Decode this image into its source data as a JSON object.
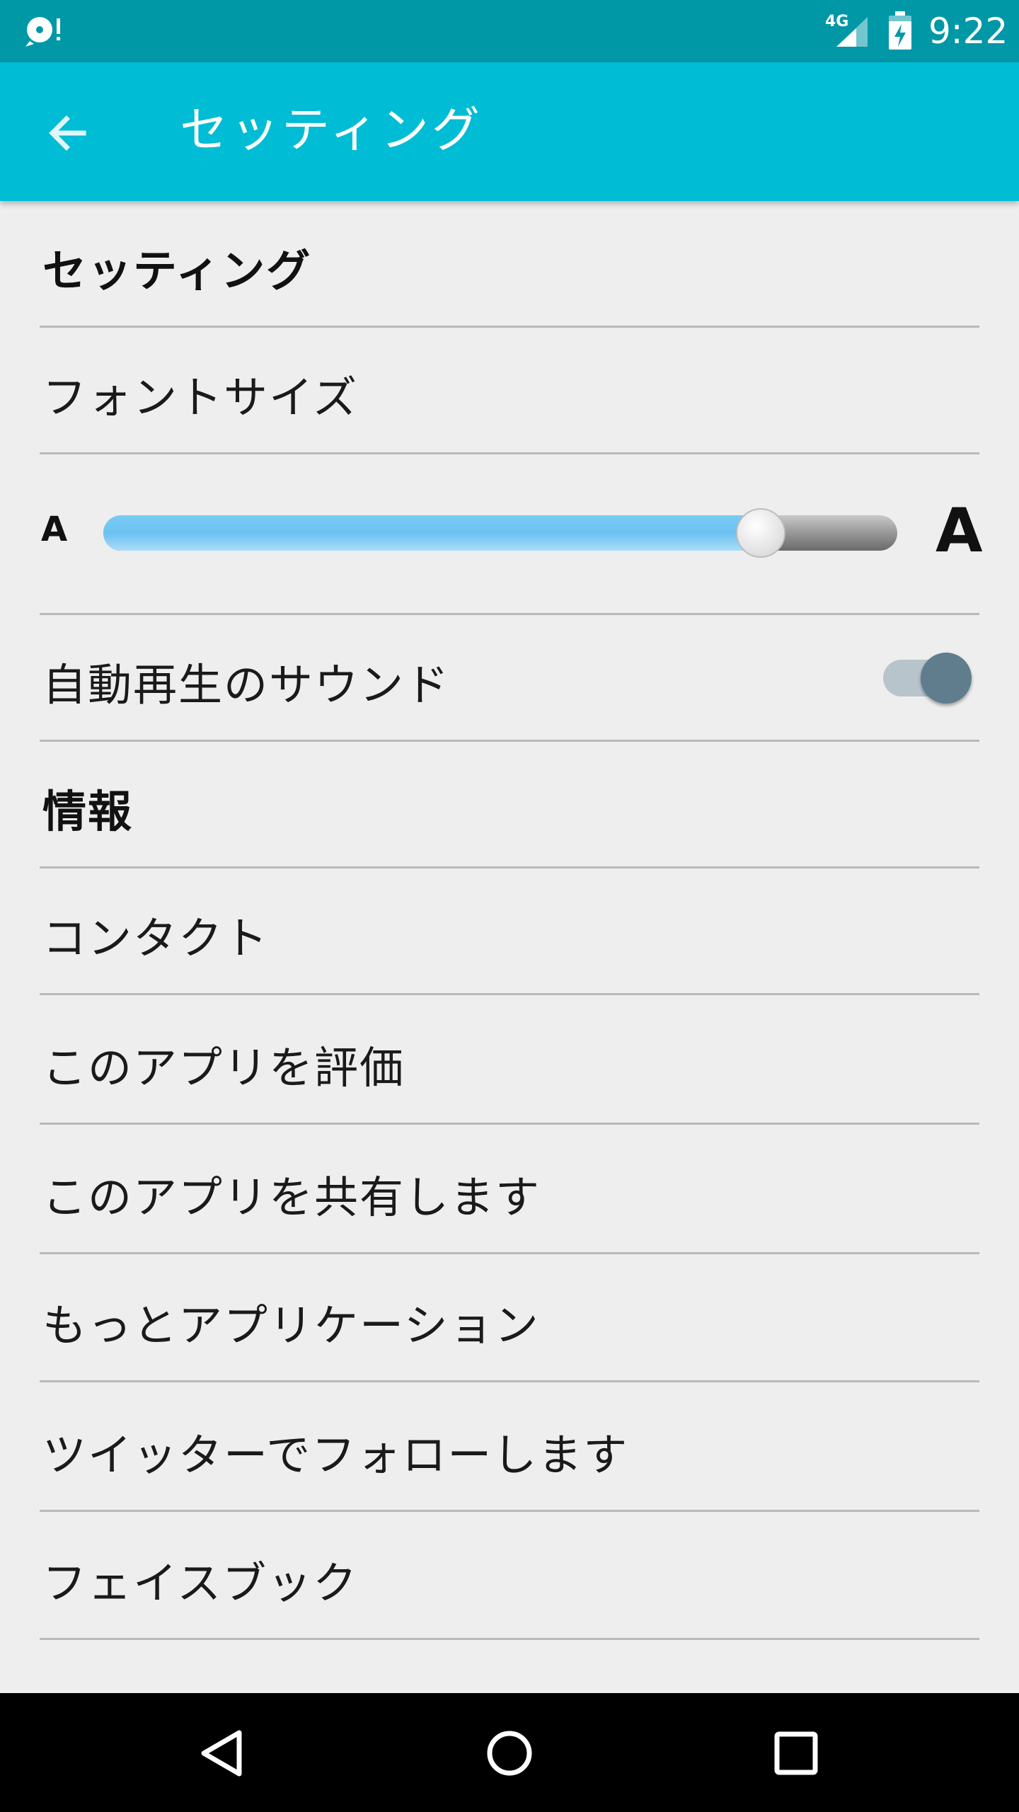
{
  "status_bar": {
    "network": "4G",
    "time": "9:22",
    "icons": [
      "notification-disc-icon",
      "signal-icon",
      "battery-charging-icon"
    ]
  },
  "app_bar": {
    "title": "セッティング",
    "back_icon": "arrow-back-icon",
    "color": "#00BCD4"
  },
  "settings": {
    "header": "セッティング",
    "font_size_label": "フォントサイズ",
    "slider": {
      "small_label": "A",
      "large_label": "A",
      "value_fraction": 0.85
    },
    "autoplay_sound_label": "自動再生のサウンド",
    "autoplay_sound_on": true
  },
  "info": {
    "header": "情報",
    "items": [
      {
        "label": "コンタクト"
      },
      {
        "label": "このアプリを評価"
      },
      {
        "label": "このアプリを共有します"
      },
      {
        "label": "もっとアプリケーション"
      },
      {
        "label": "ツイッターでフォローします"
      },
      {
        "label": "フェイスブック"
      }
    ]
  },
  "nav_bar": {
    "icons": [
      "back-triangle-icon",
      "home-circle-icon",
      "recents-square-icon"
    ]
  }
}
